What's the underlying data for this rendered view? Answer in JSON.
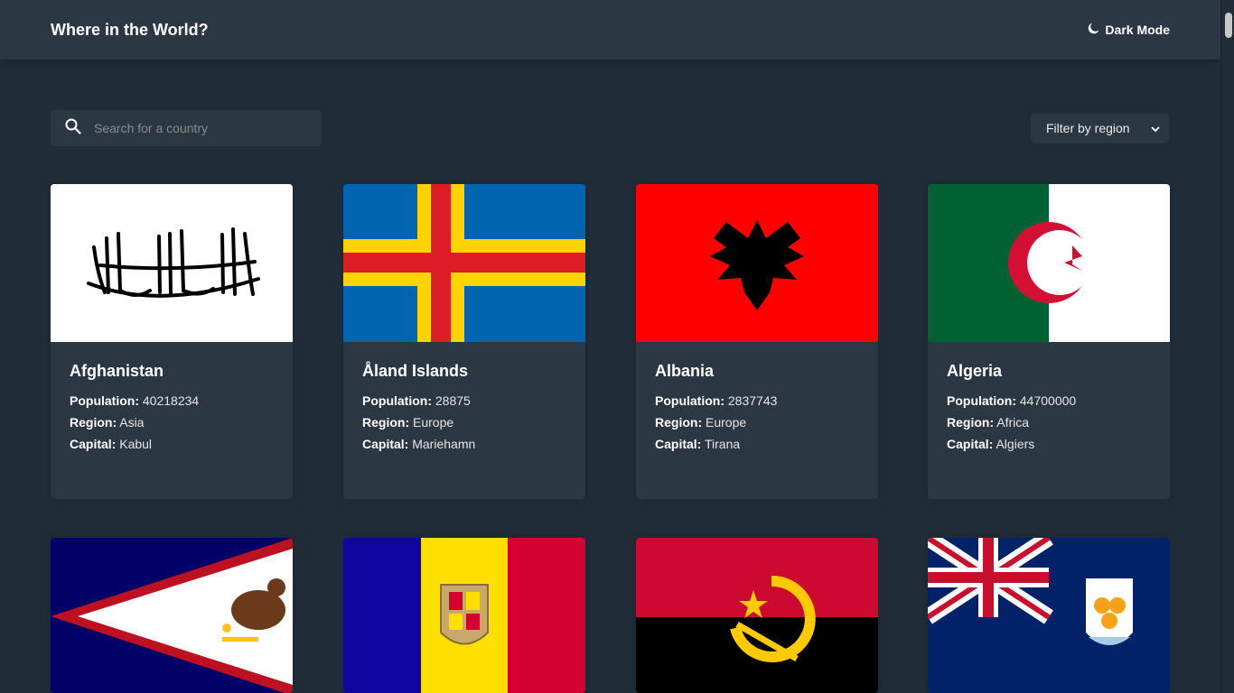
{
  "header": {
    "title": "Where in the World?",
    "theme_toggle_label": "Dark Mode"
  },
  "search": {
    "placeholder": "Search for a country",
    "value": ""
  },
  "filter": {
    "label": "Filter by region"
  },
  "stat_labels": {
    "population": "Population:",
    "region": "Region:",
    "capital": "Capital:"
  },
  "countries": [
    {
      "name": "Afghanistan",
      "population": "40218234",
      "region": "Asia",
      "capital": "Kabul"
    },
    {
      "name": "Åland Islands",
      "population": "28875",
      "region": "Europe",
      "capital": "Mariehamn"
    },
    {
      "name": "Albania",
      "population": "2837743",
      "region": "Europe",
      "capital": "Tirana"
    },
    {
      "name": "Algeria",
      "population": "44700000",
      "region": "Africa",
      "capital": "Algiers"
    }
  ],
  "colors": {
    "background": "#202c37",
    "surface": "#2b3743",
    "text": "#ffffff"
  }
}
